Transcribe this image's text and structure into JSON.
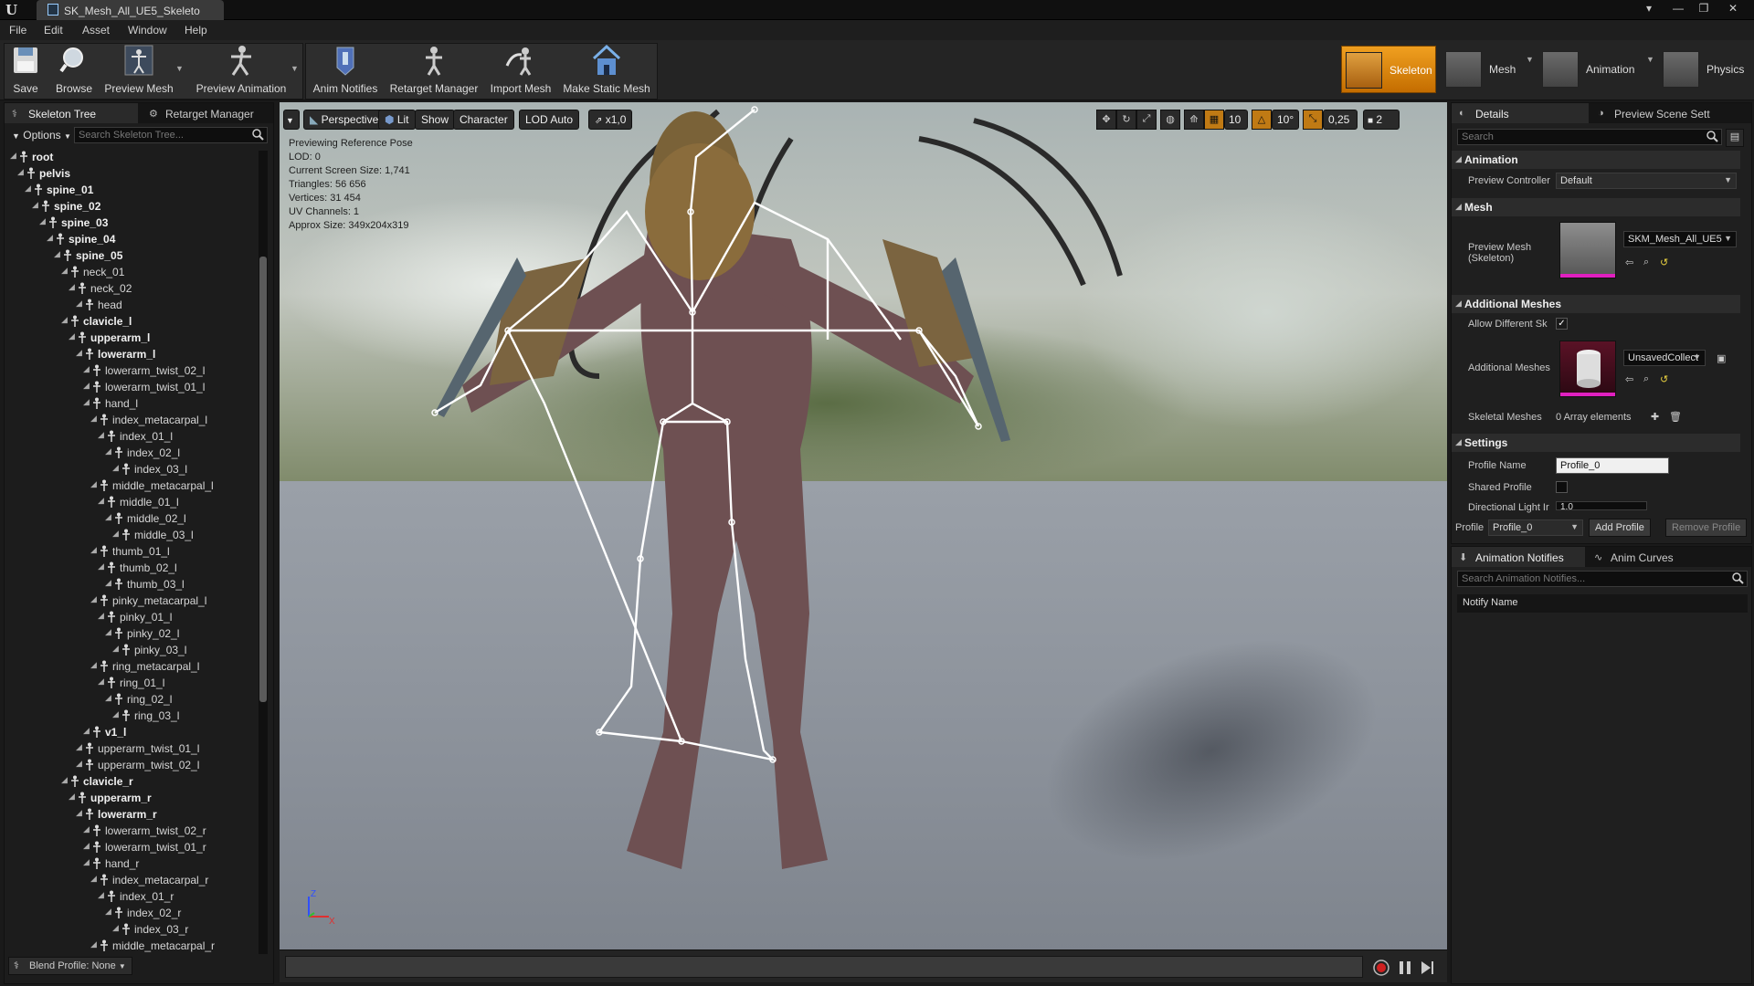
{
  "window": {
    "tab_title": "SK_Mesh_All_UE5_Skeleto",
    "controls": [
      "▾",
      "—",
      "❐",
      "✕"
    ]
  },
  "menu": [
    "File",
    "Edit",
    "Asset",
    "Window",
    "Help"
  ],
  "toolbar": {
    "save": "Save",
    "browse": "Browse",
    "preview_mesh": "Preview Mesh",
    "preview_animation": "Preview Animation",
    "anim_notifies": "Anim Notifies",
    "retarget_manager": "Retarget Manager",
    "import_mesh": "Import Mesh",
    "make_static_mesh": "Make Static Mesh"
  },
  "modes": [
    {
      "label": "Skeleton",
      "active": true
    },
    {
      "label": "Mesh",
      "active": false
    },
    {
      "label": "Animation",
      "active": false
    },
    {
      "label": "Physics",
      "active": false
    }
  ],
  "left_panel": {
    "tabs": [
      "Skeleton Tree",
      "Retarget Manager"
    ],
    "options": "Options",
    "search_placeholder": "Search Skeleton Tree...",
    "bones": [
      {
        "name": "root",
        "depth": 0,
        "bold": true
      },
      {
        "name": "pelvis",
        "depth": 1,
        "bold": true
      },
      {
        "name": "spine_01",
        "depth": 2,
        "bold": true
      },
      {
        "name": "spine_02",
        "depth": 3,
        "bold": true
      },
      {
        "name": "spine_03",
        "depth": 4,
        "bold": true
      },
      {
        "name": "spine_04",
        "depth": 5,
        "bold": true
      },
      {
        "name": "spine_05",
        "depth": 6,
        "bold": true
      },
      {
        "name": "neck_01",
        "depth": 7,
        "bold": false
      },
      {
        "name": "neck_02",
        "depth": 8,
        "bold": false
      },
      {
        "name": "head",
        "depth": 9,
        "bold": false
      },
      {
        "name": "clavicle_l",
        "depth": 7,
        "bold": true
      },
      {
        "name": "upperarm_l",
        "depth": 8,
        "bold": true
      },
      {
        "name": "lowerarm_l",
        "depth": 9,
        "bold": true
      },
      {
        "name": "lowerarm_twist_02_l",
        "depth": 10,
        "bold": false
      },
      {
        "name": "lowerarm_twist_01_l",
        "depth": 10,
        "bold": false
      },
      {
        "name": "hand_l",
        "depth": 10,
        "bold": false
      },
      {
        "name": "index_metacarpal_l",
        "depth": 11,
        "bold": false
      },
      {
        "name": "index_01_l",
        "depth": 12,
        "bold": false
      },
      {
        "name": "index_02_l",
        "depth": 13,
        "bold": false
      },
      {
        "name": "index_03_l",
        "depth": 14,
        "bold": false
      },
      {
        "name": "middle_metacarpal_l",
        "depth": 11,
        "bold": false
      },
      {
        "name": "middle_01_l",
        "depth": 12,
        "bold": false
      },
      {
        "name": "middle_02_l",
        "depth": 13,
        "bold": false
      },
      {
        "name": "middle_03_l",
        "depth": 14,
        "bold": false
      },
      {
        "name": "thumb_01_l",
        "depth": 11,
        "bold": false
      },
      {
        "name": "thumb_02_l",
        "depth": 12,
        "bold": false
      },
      {
        "name": "thumb_03_l",
        "depth": 13,
        "bold": false
      },
      {
        "name": "pinky_metacarpal_l",
        "depth": 11,
        "bold": false
      },
      {
        "name": "pinky_01_l",
        "depth": 12,
        "bold": false
      },
      {
        "name": "pinky_02_l",
        "depth": 13,
        "bold": false
      },
      {
        "name": "pinky_03_l",
        "depth": 14,
        "bold": false
      },
      {
        "name": "ring_metacarpal_l",
        "depth": 11,
        "bold": false
      },
      {
        "name": "ring_01_l",
        "depth": 12,
        "bold": false
      },
      {
        "name": "ring_02_l",
        "depth": 13,
        "bold": false
      },
      {
        "name": "ring_03_l",
        "depth": 14,
        "bold": false
      },
      {
        "name": "v1_l",
        "depth": 10,
        "bold": true
      },
      {
        "name": "upperarm_twist_01_l",
        "depth": 9,
        "bold": false
      },
      {
        "name": "upperarm_twist_02_l",
        "depth": 9,
        "bold": false
      },
      {
        "name": "clavicle_r",
        "depth": 7,
        "bold": true
      },
      {
        "name": "upperarm_r",
        "depth": 8,
        "bold": true
      },
      {
        "name": "lowerarm_r",
        "depth": 9,
        "bold": true
      },
      {
        "name": "lowerarm_twist_02_r",
        "depth": 10,
        "bold": false
      },
      {
        "name": "lowerarm_twist_01_r",
        "depth": 10,
        "bold": false
      },
      {
        "name": "hand_r",
        "depth": 10,
        "bold": false
      },
      {
        "name": "index_metacarpal_r",
        "depth": 11,
        "bold": false
      },
      {
        "name": "index_01_r",
        "depth": 12,
        "bold": false
      },
      {
        "name": "index_02_r",
        "depth": 13,
        "bold": false
      },
      {
        "name": "index_03_r",
        "depth": 14,
        "bold": false
      },
      {
        "name": "middle_metacarpal_r",
        "depth": 11,
        "bold": false
      }
    ],
    "blend_profile": "Blend Profile: None"
  },
  "viewport": {
    "perspective": "Perspective",
    "lit": "Lit",
    "show": "Show",
    "character": "Character",
    "lod": "LOD Auto",
    "speed": "x1,0",
    "grid_snap": "10",
    "rot_snap": "10°",
    "scale_snap": "0,25",
    "cam_speed": "2",
    "info": [
      "Previewing Reference Pose",
      "LOD: 0",
      "Current Screen Size: 1,741",
      "Triangles: 56 656",
      "Vertices: 31 454",
      "UV Channels: 1",
      "Approx Size: 349x204x319"
    ],
    "axis_z": "Z",
    "axis_x": "X"
  },
  "details": {
    "tabs": [
      "Details",
      "Preview Scene Sett"
    ],
    "search_placeholder": "Search",
    "animation_section": "Animation",
    "preview_controller_label": "Preview Controller",
    "preview_controller_value": "Default",
    "mesh_section": "Mesh",
    "preview_mesh_label": "Preview Mesh (Skeleton)",
    "preview_mesh_value": "SKM_Mesh_All_UE5",
    "additional_meshes_section": "Additional Meshes",
    "allow_different_label": "Allow Different Sk",
    "additional_meshes_label": "Additional Meshes",
    "additional_meshes_value": "UnsavedCollect",
    "skeletal_meshes_label": "Skeletal Meshes",
    "skeletal_meshes_value": "0 Array elements",
    "settings_section": "Settings",
    "profile_name_label": "Profile Name",
    "profile_name_value": "Profile_0",
    "shared_profile_label": "Shared Profile",
    "directional_light_label": "Directional Light Ir",
    "directional_light_value": "1,0",
    "profile_label": "Profile",
    "profile_value": "Profile_0",
    "add_profile": "Add Profile",
    "remove_profile": "Remove Profile"
  },
  "notifies": {
    "tabs": [
      "Animation Notifies",
      "Anim Curves"
    ],
    "search_placeholder": "Search Animation Notifies...",
    "column_header": "Notify Name"
  },
  "colors": {
    "accent_orange": "#e8961e",
    "panel_bg": "#1f1f1f",
    "thumb_magenta": "#e020c0"
  }
}
